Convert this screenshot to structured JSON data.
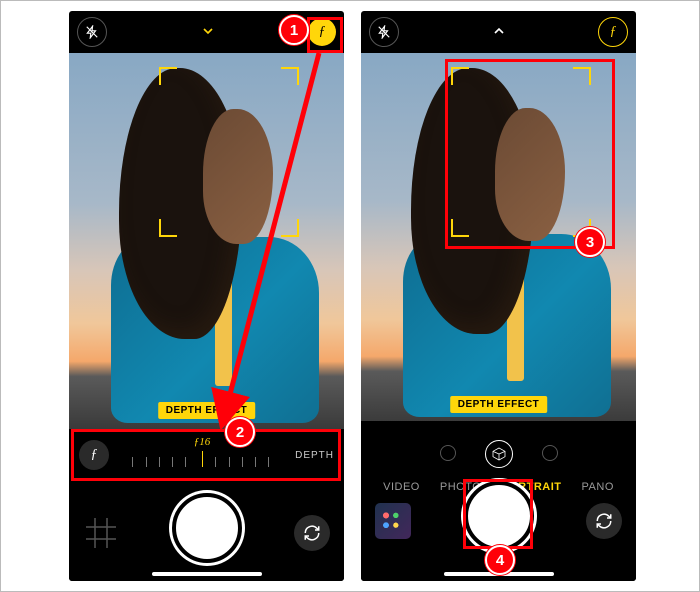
{
  "colors": {
    "accent": "#ffd60a",
    "annotation": "#ff0008"
  },
  "left": {
    "depth_effect_badge": "DEPTH EFFECT",
    "aperture_value": "ƒ16",
    "depth_label": "DEPTH",
    "icons": {
      "flash": "flash-off",
      "expand": "chevron-down",
      "aperture": "f"
    }
  },
  "right": {
    "depth_effect_badge": "DEPTH EFFECT",
    "modes": [
      {
        "label": "VIDEO",
        "active": false
      },
      {
        "label": "PHOTO",
        "active": false
      },
      {
        "label": "PORTRAIT",
        "active": true
      },
      {
        "label": "PANO",
        "active": false
      }
    ],
    "icons": {
      "flash": "flash-off",
      "expand": "chevron-up",
      "aperture": "f"
    }
  },
  "annotations": {
    "steps": [
      {
        "n": "1",
        "target": "aperture-button"
      },
      {
        "n": "2",
        "target": "depth-slider"
      },
      {
        "n": "3",
        "target": "focus-frame"
      },
      {
        "n": "4",
        "target": "shutter-button"
      }
    ]
  }
}
